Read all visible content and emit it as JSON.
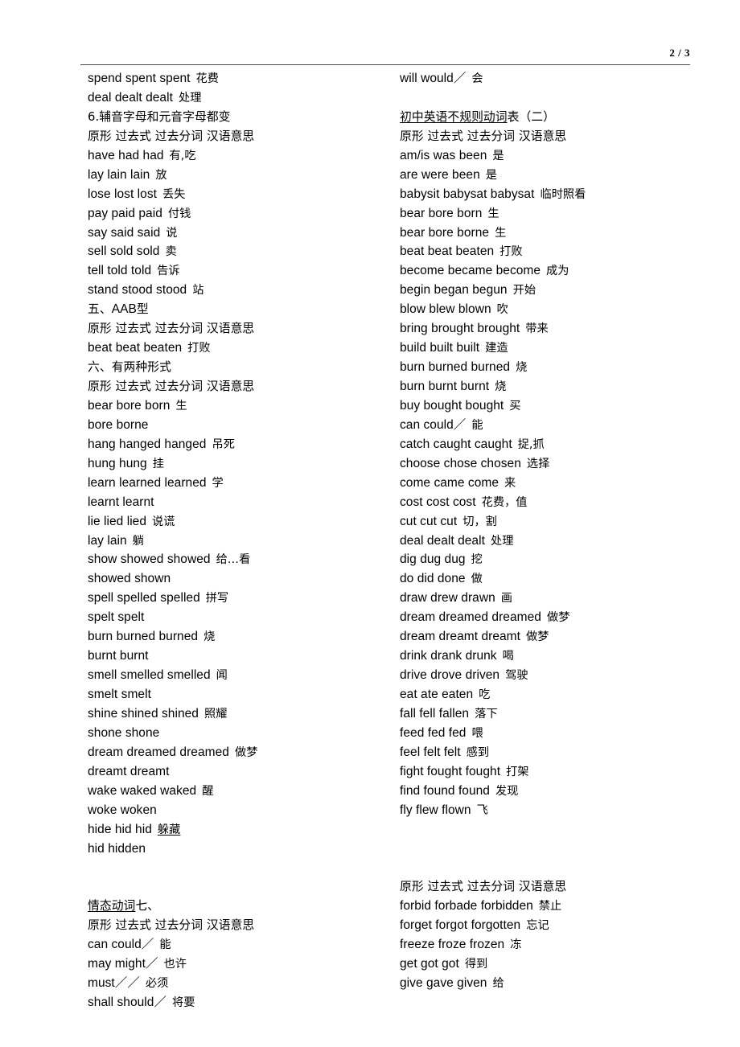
{
  "header": {
    "page_number": "2 / 3"
  },
  "left_column": [
    {
      "en": "spend spent spent",
      "cn": "花费"
    },
    {
      "en": "deal dealt dealt",
      "cn": "处理"
    },
    {
      "en": "",
      "cn": "6.辅音字母和元音字母都变",
      "heading": true
    },
    {
      "en": "",
      "cn": "原形 过去式 过去分词 汉语意思",
      "heading": true
    },
    {
      "en": "have had had",
      "cn": "有,吃"
    },
    {
      "en": "lay lain lain",
      "cn": "放"
    },
    {
      "en": "lose lost lost",
      "cn": "丢失"
    },
    {
      "en": "pay paid paid",
      "cn": "付钱"
    },
    {
      "en": "say said said",
      "cn": "说"
    },
    {
      "en": "sell sold sold",
      "cn": "卖"
    },
    {
      "en": "tell told told",
      "cn": "告诉"
    },
    {
      "en": "stand stood stood",
      "cn": "站"
    },
    {
      "en": "",
      "cn": "五、",
      "en_after": "AAB",
      "cn_after": "型",
      "heading": true
    },
    {
      "en": "",
      "cn": "原形 过去式 过去分词 汉语意思",
      "heading": true
    },
    {
      "en": "beat beat beaten",
      "cn": "打败"
    },
    {
      "en": "",
      "cn": "六、有两种形式",
      "heading": true
    },
    {
      "en": "",
      "cn": "原形 过去式 过去分词 汉语意思",
      "heading": true
    },
    {
      "en": "bear bore born",
      "cn": "生"
    },
    {
      "en": "bore borne",
      "cn": ""
    },
    {
      "en": "hang hanged hanged",
      "cn": "吊死"
    },
    {
      "en": "hung hung",
      "cn": "挂"
    },
    {
      "en": "learn learned learned",
      "cn": "学"
    },
    {
      "en": "learnt learnt",
      "cn": ""
    },
    {
      "en": "lie lied lied",
      "cn": "说谎"
    },
    {
      "en": "lay lain",
      "cn": "躺"
    },
    {
      "en": "show showed showed",
      "cn": "给…看"
    },
    {
      "en": "showed shown",
      "cn": ""
    },
    {
      "en": "spell spelled spelled",
      "cn": "拼写"
    },
    {
      "en": "spelt spelt",
      "cn": ""
    },
    {
      "en": "burn burned burned",
      "cn": "烧"
    },
    {
      "en": "burnt burnt",
      "cn": ""
    },
    {
      "en": "smell smelled smelled",
      "cn": "闻"
    },
    {
      "en": "smelt smelt",
      "cn": ""
    },
    {
      "en": "shine shined shined",
      "cn": "照耀"
    },
    {
      "en": "shone shone",
      "cn": ""
    },
    {
      "en": "dream dreamed dreamed",
      "cn": "做梦"
    },
    {
      "en": "dreamt dreamt",
      "cn": ""
    },
    {
      "en": "wake waked waked",
      "cn": "醒"
    },
    {
      "en": "woke woken",
      "cn": ""
    },
    {
      "en": "hide hid hid",
      "cn": "躲藏",
      "cn_underline": true
    },
    {
      "en": "hid hidden",
      "cn": ""
    },
    {
      "blank": true
    },
    {
      "blank": true
    },
    {
      "en": "",
      "cn": "七、",
      "cn_u": "情态动词",
      "heading": true
    },
    {
      "en": "",
      "cn": "原形 过去式 过去分词 汉语意思",
      "heading": true
    },
    {
      "en": "can could／",
      "cn": "能"
    },
    {
      "en": "may might／",
      "cn": "也许"
    },
    {
      "en": "must／／",
      "cn": "必须"
    },
    {
      "en": "shall should／",
      "cn": "将要"
    }
  ],
  "right_column": [
    {
      "en": "will would／",
      "cn": "会"
    },
    {
      "blank": true
    },
    {
      "en": "",
      "cn_u": "初中英语不规则动词",
      "cn": "表（二）",
      "heading": true
    },
    {
      "en": "",
      "cn": "原形 过去式 过去分词 汉语意思",
      "heading": true
    },
    {
      "en": "am/is was been",
      "cn": "是"
    },
    {
      "en": "are were been",
      "cn": "是"
    },
    {
      "en": "babysit babysat babysat",
      "cn": "临时照看"
    },
    {
      "en": "bear bore born",
      "cn": "生"
    },
    {
      "en": "bear bore borne",
      "cn": "生"
    },
    {
      "en": "beat beat beaten",
      "cn": "打败"
    },
    {
      "en": "become became become",
      "cn": "成为"
    },
    {
      "en": "begin began begun",
      "cn": "开始"
    },
    {
      "en": "blow blew blown",
      "cn": "吹"
    },
    {
      "en": "bring brought brought",
      "cn": "带来"
    },
    {
      "en": "build built built",
      "cn": "建造"
    },
    {
      "en": "burn burned burned",
      "cn": "烧"
    },
    {
      "en": "burn burnt burnt",
      "cn": "烧"
    },
    {
      "en": "buy bought bought",
      "cn": "买"
    },
    {
      "en": "can could／",
      "cn": "能"
    },
    {
      "en": "catch caught caught",
      "cn": "捉,抓"
    },
    {
      "en": "choose chose chosen",
      "cn": "选择"
    },
    {
      "en": "come came come",
      "cn": "来"
    },
    {
      "en": "cost cost cost",
      "cn": "花费，值"
    },
    {
      "en": "cut cut cut",
      "cn": "切，割"
    },
    {
      "en": "deal dealt dealt",
      "cn": "处理"
    },
    {
      "en": "dig dug dug",
      "cn": "挖"
    },
    {
      "en": "do did done",
      "cn": "做"
    },
    {
      "en": "draw drew drawn",
      "cn": "画"
    },
    {
      "en": "dream dreamed dreamed",
      "cn": "做梦"
    },
    {
      "en": "dream dreamt dreamt",
      "cn": "做梦"
    },
    {
      "en": "drink drank drunk",
      "cn": "喝"
    },
    {
      "en": "drive drove driven",
      "cn": "驾驶"
    },
    {
      "en": "eat ate eaten",
      "cn": "吃"
    },
    {
      "en": "fall fell fallen",
      "cn": "落下"
    },
    {
      "en": "feed fed fed",
      "cn": "喂"
    },
    {
      "en": "feel felt felt",
      "cn": "感到"
    },
    {
      "en": "fight fought fought",
      "cn": "打架"
    },
    {
      "en": "find found found",
      "cn": "发现"
    },
    {
      "en": "fly flew flown",
      "cn": "飞"
    },
    {
      "blank": true
    },
    {
      "blank": true
    },
    {
      "blank": true
    },
    {
      "en": "",
      "cn": "原形 过去式 过去分词 汉语意思",
      "heading": true
    },
    {
      "en": "forbid forbade forbidden",
      "cn": "禁止"
    },
    {
      "en": "forget forgot forgotten",
      "cn": "忘记"
    },
    {
      "en": "freeze froze frozen",
      "cn": "冻"
    },
    {
      "en": "get got got",
      "cn": "得到"
    },
    {
      "en": "give gave given",
      "cn": "给"
    }
  ]
}
